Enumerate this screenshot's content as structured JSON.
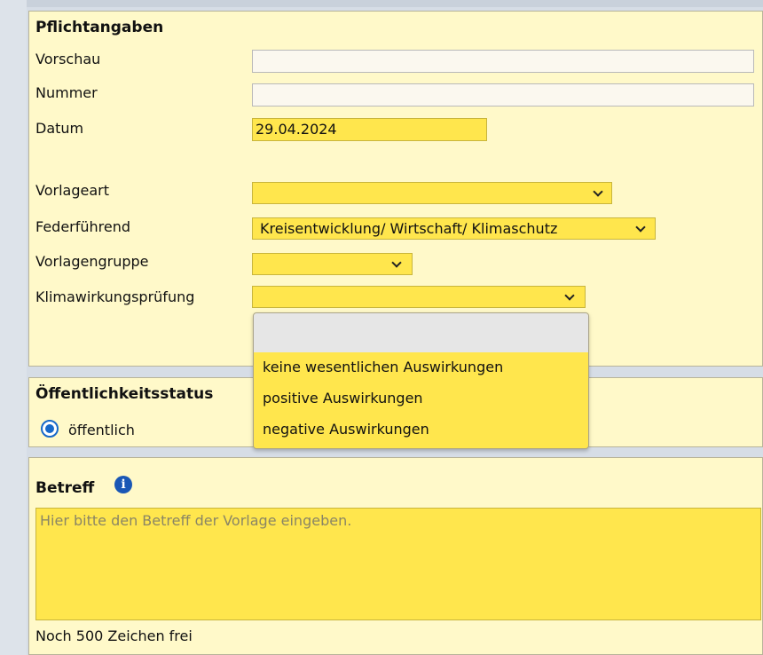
{
  "pflicht": {
    "legend": "Pflichtangaben",
    "vorschau_label": "Vorschau",
    "vorschau_value": "",
    "nummer_label": "Nummer",
    "nummer_value": "",
    "datum_label": "Datum",
    "datum_value": "29.04.2024",
    "vorlageart_label": "Vorlageart",
    "vorlageart_value": "",
    "federfuehrend_label": "Federführend",
    "federfuehrend_value": "Kreisentwicklung/ Wirtschaft/ Klimaschutz",
    "vorlagengruppe_label": "Vorlagengruppe",
    "vorlagengruppe_value": "",
    "klima_label": "Klimawirkungsprüfung",
    "klima_value": ""
  },
  "dropdown": {
    "options": [
      "",
      "keine wesentlichen Auswirkungen",
      "positive Auswirkungen",
      "negative Auswirkungen"
    ]
  },
  "oeffentlichkeit": {
    "legend": "Öffentlichkeitsstatus",
    "radio_label": "öffentlich"
  },
  "betreff": {
    "legend": "Betreff",
    "info_glyph": "i",
    "placeholder": "Hier bitte den Betreff der Vorlage eingeben.",
    "counter": "Noch 500 Zeichen frei"
  },
  "colors": {
    "field_yellow": "#ffe64d",
    "panel": "#fff9c9",
    "radio_blue": "#1668c9"
  }
}
